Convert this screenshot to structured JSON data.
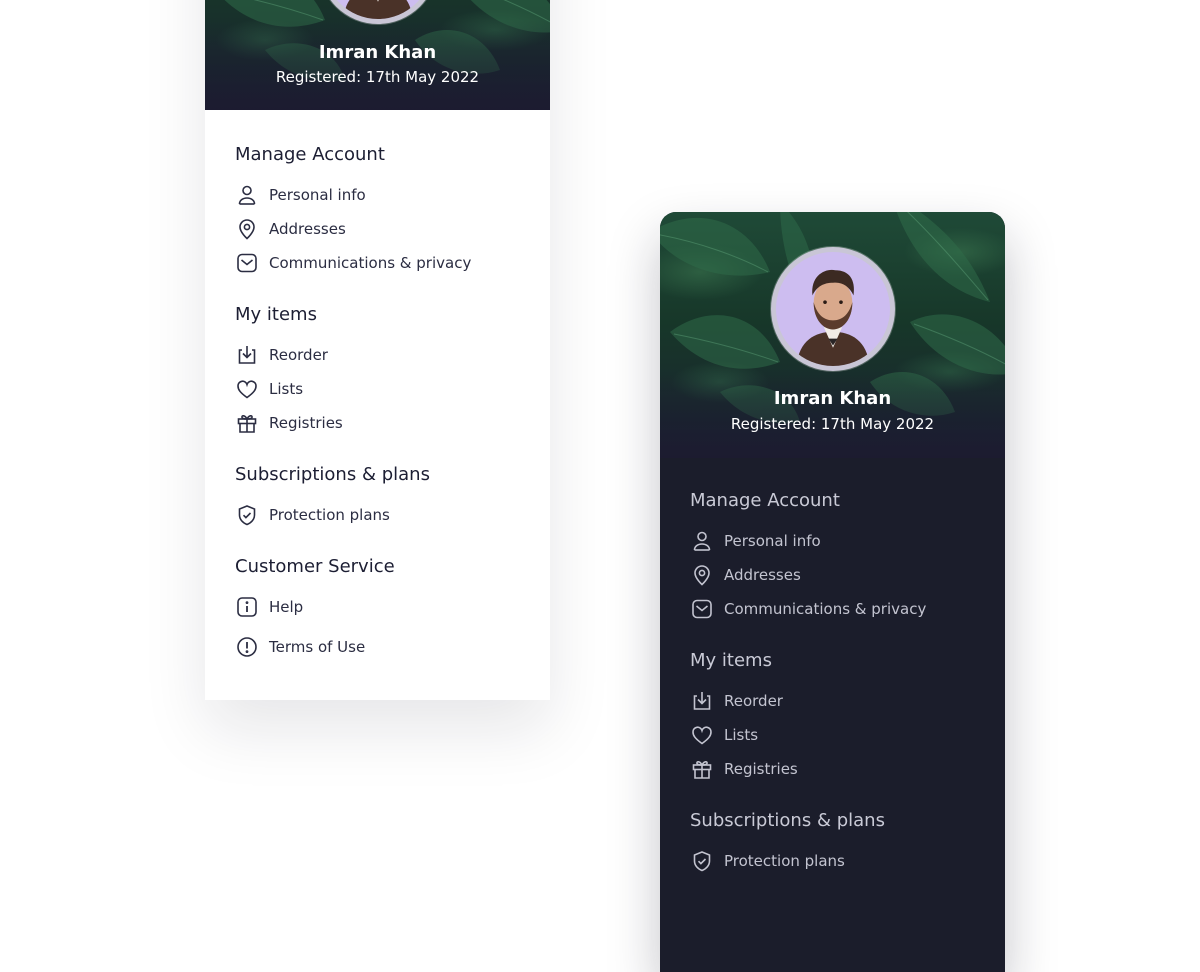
{
  "profile": {
    "name": "Imran Khan",
    "registered": "Registered: 17th May 2022"
  },
  "sections": [
    {
      "title": "Manage Account",
      "items": [
        {
          "label": "Personal info",
          "icon": "user-icon"
        },
        {
          "label": "Addresses",
          "icon": "location-pin-icon"
        },
        {
          "label": "Communications & privacy",
          "icon": "mail-icon"
        }
      ]
    },
    {
      "title": "My items",
      "items": [
        {
          "label": "Reorder",
          "icon": "download-tray-icon"
        },
        {
          "label": "Lists",
          "icon": "heart-icon"
        },
        {
          "label": "Registries",
          "icon": "gift-icon"
        }
      ]
    },
    {
      "title": "Subscriptions & plans",
      "items": [
        {
          "label": "Protection plans",
          "icon": "shield-check-icon"
        }
      ]
    },
    {
      "title": "Customer Service",
      "items": [
        {
          "label": "Help",
          "icon": "info-icon"
        },
        {
          "label": "Terms of Use",
          "icon": "alert-circle-icon"
        }
      ]
    }
  ],
  "colors": {
    "light_text": "#2b2d42",
    "dark_bg": "#1b1d2b",
    "dark_text": "#c3c4d0",
    "avatar_bg": "#cdbdf0",
    "hero_green": "#1f4a37"
  }
}
